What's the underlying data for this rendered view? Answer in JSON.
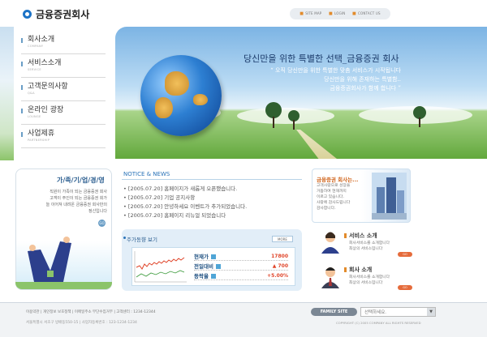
{
  "header": {
    "logo_text": "금융증권회사",
    "top_nav": [
      "SITE MAP",
      "LOGIN",
      "CONTACT US"
    ]
  },
  "menu": [
    {
      "label": "회사소개",
      "sub": "COMPANY"
    },
    {
      "label": "서비스소개",
      "sub": "SERVICE"
    },
    {
      "label": "고객문의사항",
      "sub": "Q&A"
    },
    {
      "label": "온라인 광장",
      "sub": "LOUNGE"
    },
    {
      "label": "사업제휴",
      "sub": "PARTNERSHIP"
    }
  ],
  "hero": {
    "headline": "당신만을 위한 특별한 선택_금융증권 회사",
    "quote_lines": [
      "“ 오직 당신만을 위한 특별한 맞춤 서비스가 시작됩니다",
      "당신만을 위해 존재하는 특별함..",
      "금융증권회사가 함께 합니다 ”"
    ]
  },
  "left_box": {
    "title": "가/족/기/업/경/영",
    "text_lines": [
      "직원이 가족이 되는 금융증권 회사",
      "고객이 주인이 되는 금융증권 회가",
      "늘 이어져 내려온 금융증권 회사만의",
      "정신입니다"
    ],
    "go_label": "GO"
  },
  "notice": {
    "title": "NOTICE & NEWS",
    "items": [
      {
        "date": "[2005.07.20]",
        "text": "홈페이지가 새롭게 오픈했습니다."
      },
      {
        "date": "[2005.07.20]",
        "text": "기업 공지사항"
      },
      {
        "date": "[2005.07.20]",
        "text": "안녕하세요 이벤트가 추가되었습니다."
      },
      {
        "date": "[2005.07.20]",
        "text": "홈페이지 리뉴얼 되었습니다"
      }
    ]
  },
  "stock": {
    "title": "주가동향 보기",
    "more_label": "MORE",
    "rows": [
      {
        "label": "현재가",
        "value": "17800"
      },
      {
        "label": "전일대비",
        "value": "▲ 700"
      },
      {
        "label": "등락율",
        "value": "+5.00%"
      }
    ]
  },
  "promo": {
    "title": "금융증권 회사는...",
    "text_lines": [
      "고객사랑으로 성장을",
      "거듭하여 현재까지",
      "이르고 있습니다.",
      "사랑에 감사드립니다",
      "감사합니다."
    ]
  },
  "cards": [
    {
      "title": "서비스 소개",
      "line1": "회사서비스를 소개합니다",
      "line2": "최상의 서비스입니다",
      "go_label": "GO"
    },
    {
      "title": "회사 소개",
      "line1": "회사서비스를 소개합니다",
      "line2": "최상의 서비스입니다",
      "go_label": "GO"
    }
  ],
  "footer": {
    "links": [
      "이용약관",
      "개인정보 보호정책",
      "이메일주소 무단수집거부",
      "고객센터 : 1234-12344"
    ],
    "address": "서울특별시 서초구 방배동550-15  |  사업자등록번호 : 123-1234-1234",
    "family_label": "FAMILY SITE",
    "select_value": "선택하세요.",
    "copyright": "COPYRIGHT (C) 2005 COMPANY ALL RIGHTS RESERVED"
  },
  "colors": {
    "brand_blue": "#1d73c6",
    "accent_orange": "#e28b2b",
    "up_red": "#e0452a"
  }
}
